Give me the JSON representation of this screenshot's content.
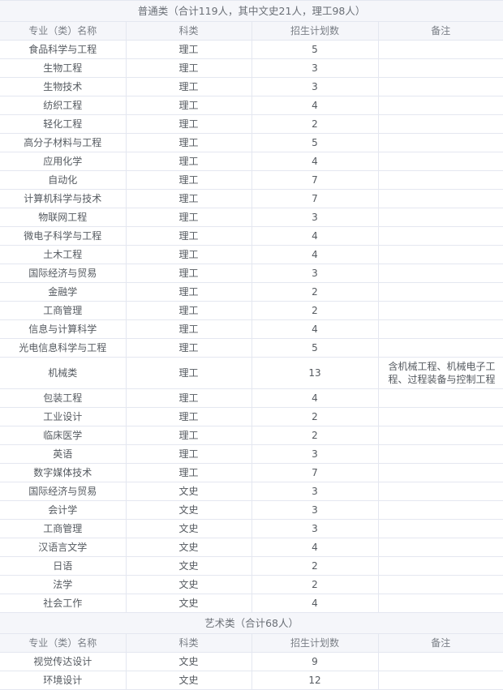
{
  "columns": [
    "专业（类）名称",
    "科类",
    "招生计划数",
    "备注"
  ],
  "sections": [
    {
      "title": "普通类（合计119人，其中文史21人，理工98人）",
      "rows": [
        {
          "name": "食品科学与工程",
          "category": "理工",
          "count": "5",
          "note": ""
        },
        {
          "name": "生物工程",
          "category": "理工",
          "count": "3",
          "note": ""
        },
        {
          "name": "生物技术",
          "category": "理工",
          "count": "3",
          "note": ""
        },
        {
          "name": "纺织工程",
          "category": "理工",
          "count": "4",
          "note": ""
        },
        {
          "name": "轻化工程",
          "category": "理工",
          "count": "2",
          "note": ""
        },
        {
          "name": "高分子材料与工程",
          "category": "理工",
          "count": "5",
          "note": ""
        },
        {
          "name": "应用化学",
          "category": "理工",
          "count": "4",
          "note": ""
        },
        {
          "name": "自动化",
          "category": "理工",
          "count": "7",
          "note": ""
        },
        {
          "name": "计算机科学与技术",
          "category": "理工",
          "count": "7",
          "note": ""
        },
        {
          "name": "物联网工程",
          "category": "理工",
          "count": "3",
          "note": ""
        },
        {
          "name": "微电子科学与工程",
          "category": "理工",
          "count": "4",
          "note": ""
        },
        {
          "name": "土木工程",
          "category": "理工",
          "count": "4",
          "note": ""
        },
        {
          "name": "国际经济与贸易",
          "category": "理工",
          "count": "3",
          "note": ""
        },
        {
          "name": "金融学",
          "category": "理工",
          "count": "2",
          "note": ""
        },
        {
          "name": "工商管理",
          "category": "理工",
          "count": "2",
          "note": ""
        },
        {
          "name": "信息与计算科学",
          "category": "理工",
          "count": "4",
          "note": ""
        },
        {
          "name": "光电信息科学与工程",
          "category": "理工",
          "count": "5",
          "note": ""
        },
        {
          "name": "机械类",
          "category": "理工",
          "count": "13",
          "note": "含机械工程、机械电子工程、过程装备与控制工程"
        },
        {
          "name": "包装工程",
          "category": "理工",
          "count": "4",
          "note": ""
        },
        {
          "name": "工业设计",
          "category": "理工",
          "count": "2",
          "note": ""
        },
        {
          "name": "临床医学",
          "category": "理工",
          "count": "2",
          "note": ""
        },
        {
          "name": "英语",
          "category": "理工",
          "count": "3",
          "note": ""
        },
        {
          "name": "数字媒体技术",
          "category": "理工",
          "count": "7",
          "note": ""
        },
        {
          "name": "国际经济与贸易",
          "category": "文史",
          "count": "3",
          "note": ""
        },
        {
          "name": "会计学",
          "category": "文史",
          "count": "3",
          "note": ""
        },
        {
          "name": "工商管理",
          "category": "文史",
          "count": "3",
          "note": ""
        },
        {
          "name": "汉语言文学",
          "category": "文史",
          "count": "4",
          "note": ""
        },
        {
          "name": "日语",
          "category": "文史",
          "count": "2",
          "note": ""
        },
        {
          "name": "法学",
          "category": "文史",
          "count": "2",
          "note": ""
        },
        {
          "name": "社会工作",
          "category": "文史",
          "count": "4",
          "note": ""
        }
      ]
    },
    {
      "title": "艺术类（合计68人）",
      "rows": [
        {
          "name": "视觉传达设计",
          "category": "文史",
          "count": "9",
          "note": ""
        },
        {
          "name": "环境设计",
          "category": "文史",
          "count": "12",
          "note": ""
        }
      ]
    }
  ]
}
